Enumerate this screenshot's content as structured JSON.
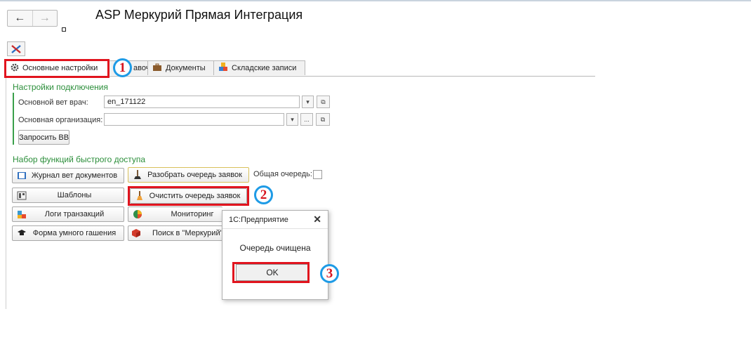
{
  "window": {
    "title": "ASP Меркурий Прямая Интеграция"
  },
  "nav": {
    "back": "←",
    "forward": "→"
  },
  "tabs": [
    {
      "label": "Основные настройки",
      "icon": "gear-icon"
    },
    {
      "label": "авочники",
      "icon": ""
    },
    {
      "label": "Документы",
      "icon": "briefcase-icon"
    },
    {
      "label": "Складские записи",
      "icon": "boxes-icon"
    }
  ],
  "connection": {
    "section_title": "Настройки подключения",
    "vet_label": "Основной вет врач:",
    "vet_value": "en_171122",
    "org_label": "Основная организация:",
    "org_value": "",
    "request_button": "Запросить ВВ",
    "dropdown_glyph": "▾",
    "open_glyph": "⧉",
    "ellipsis_glyph": "..."
  },
  "quick": {
    "section_title": "Набор функций быстрого доступа",
    "common_queue_label": "Общая очередь:",
    "buttons": {
      "journal": "Журнал вет документов",
      "parse_queue": "Разобрать очередь заявок",
      "templates": "Шаблоны",
      "clear_queue": "Очистить очередь заявок",
      "logs": "Логи транзакций",
      "monitoring": "Мониторинг",
      "smart_form": "Форма умного гашения",
      "search": "Поиск в \"Меркурий\""
    }
  },
  "dialog": {
    "title": "1С:Предприятие",
    "close": "✕",
    "message": "Очередь очищена",
    "ok": "OK"
  },
  "annotations": {
    "one": "1",
    "two": "2",
    "three": "3"
  },
  "colors": {
    "highlight": "#e1141e",
    "badge_ring": "#1e9be6",
    "section": "#2b8e3a"
  }
}
